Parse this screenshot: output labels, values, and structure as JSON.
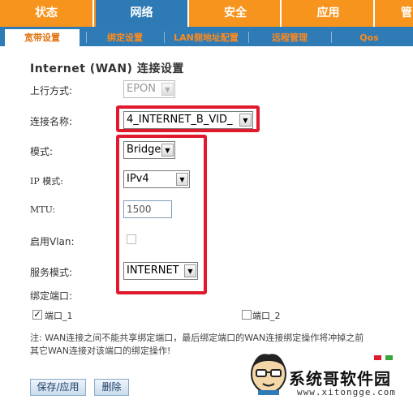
{
  "topnav": {
    "tabs": [
      {
        "label": "状态"
      },
      {
        "label": "网络"
      },
      {
        "label": "安全"
      },
      {
        "label": "应用"
      },
      {
        "label": "管"
      }
    ]
  },
  "subnav": {
    "items": [
      {
        "label": "宽带设置"
      },
      {
        "label": "绑定设置"
      },
      {
        "label": "LAN侧地址配置"
      },
      {
        "label": "远程管理"
      },
      {
        "label": "Qos"
      }
    ]
  },
  "form": {
    "title": "Internet (WAN) 连接设置",
    "upstream": {
      "label": "上行方式:",
      "value": "EPON"
    },
    "connection_name": {
      "label": "连接名称:",
      "value": "4_INTERNET_B_VID_"
    },
    "mode": {
      "label": "模式:",
      "value": "Bridge"
    },
    "ip_mode": {
      "label": "IP 模式:",
      "value": "IPv4"
    },
    "mtu": {
      "label": "MTU:",
      "value": "1500"
    },
    "vlan": {
      "label": "启用Vlan:"
    },
    "service_mode": {
      "label": "服务模式:",
      "value": "INTERNET"
    },
    "bind_port": {
      "label": "绑定端口:"
    },
    "ports": [
      {
        "label": "端口_1",
        "checked": true
      },
      {
        "label": "端口_2",
        "checked": false
      }
    ],
    "note_line1": "注: WAN连接之间不能共享绑定端口，最后绑定端口的WAN连接绑定操作将冲掉之前",
    "note_line2": "其它WAN连接对该端口的绑定操作!",
    "save_button": "保存/应用",
    "delete_button": "删除"
  },
  "watermark": {
    "brand": "系统哥软件园",
    "url": "www.xitongge.com"
  },
  "colors": {
    "nav_orange": "#f7941d",
    "nav_blue": "#2e7ab5",
    "highlight_red": "#e0192c"
  }
}
